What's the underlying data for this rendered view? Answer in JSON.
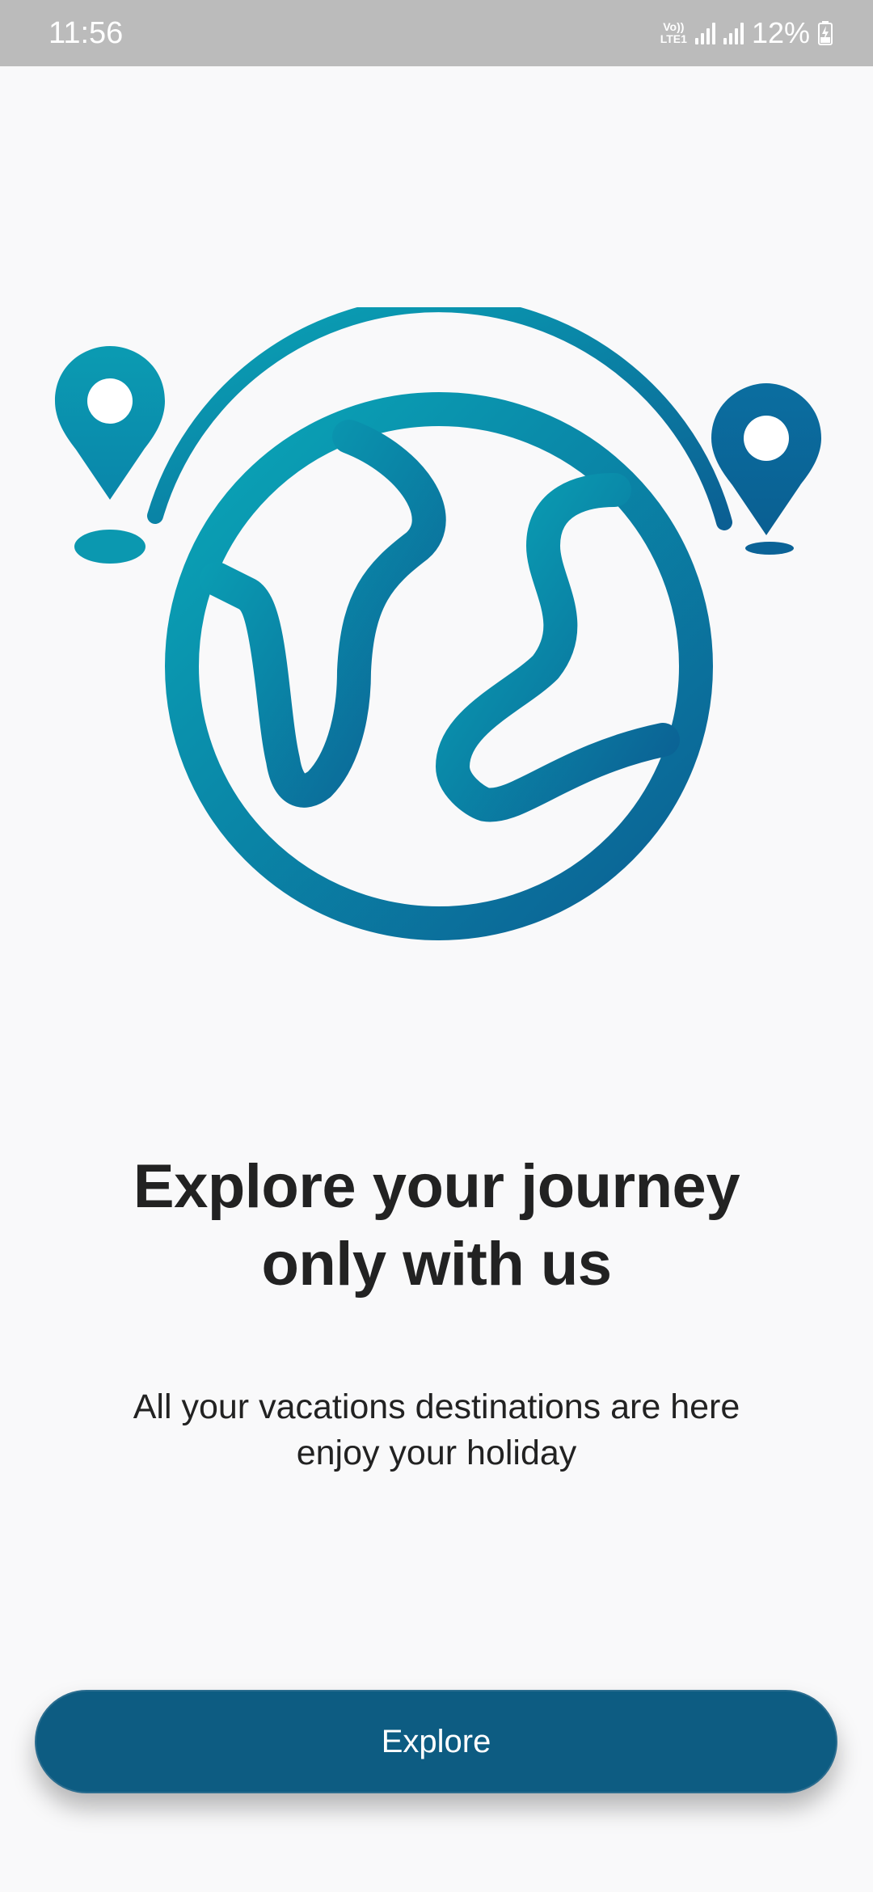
{
  "status_bar": {
    "time": "11:56",
    "network_top": "Vo))",
    "network_bottom": "LTE1",
    "battery_percent": "12%"
  },
  "illustration": {
    "icon": "globe-with-location-pins-icon",
    "gradient_start": "#0aa7b8",
    "gradient_end": "#0b5f93"
  },
  "onboarding": {
    "title_line1": "Explore your journey",
    "title_line2": "only with us",
    "subtitle_line1": "All your vacations destinations are here",
    "subtitle_line2": "enjoy your holiday"
  },
  "actions": {
    "explore_label": "Explore"
  },
  "colors": {
    "background": "#f9f9fa",
    "button": "#0d5c82",
    "status_bar": "#bbbbbb"
  }
}
